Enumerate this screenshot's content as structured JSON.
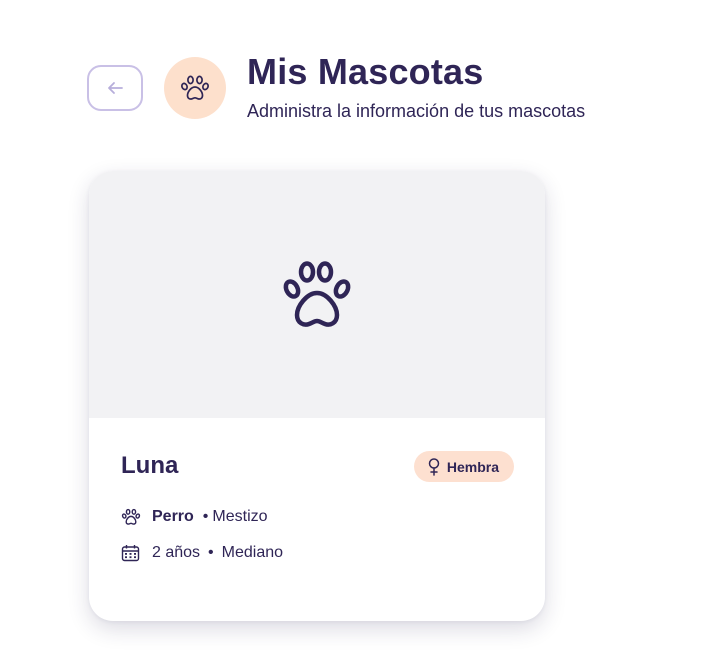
{
  "header": {
    "back_icon": "arrow-left-icon",
    "avatar_icon": "paw-icon",
    "title": "Mis Mascotas",
    "subtitle": "Administra la información de tus mascotas"
  },
  "pets": [
    {
      "photo_icon": "paw-icon",
      "name": "Luna",
      "gender": "Hembra",
      "gender_icon": "female-icon",
      "species": "Perro",
      "breed": "Mestizo",
      "age": "2 años",
      "size": "Mediano",
      "separator": "•"
    }
  ],
  "colors": {
    "primary_text": "#2f2556",
    "back_button_border": "#c9c0e6",
    "avatar_background": "#fde0cc",
    "badge_background": "#fde0d0",
    "photo_background": "#f2f2f4"
  }
}
